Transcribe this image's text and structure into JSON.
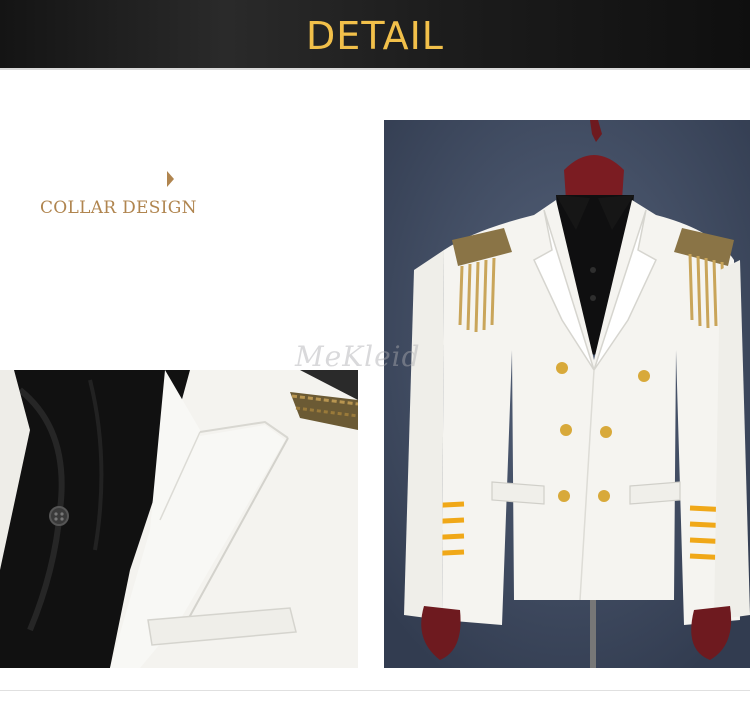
{
  "banner": {
    "title": "DETAIL",
    "title_color": "#f2c04a",
    "background": "#1b1b1b"
  },
  "section": {
    "label": "COLLAR DESIGN",
    "label_color": "#b0854f",
    "marker_icon": "triangle-right-icon"
  },
  "watermark": {
    "text": "MeKleid"
  },
  "photos": [
    {
      "subject": "collar-close-up",
      "jacket_color": "#f4f3ef",
      "shirt_color": "#121212"
    },
    {
      "subject": "white-jacket-on-mannequin",
      "background_color": "#3f4c63",
      "stripe_color": "#f0a818",
      "button_color": "#d8a93a"
    }
  ]
}
